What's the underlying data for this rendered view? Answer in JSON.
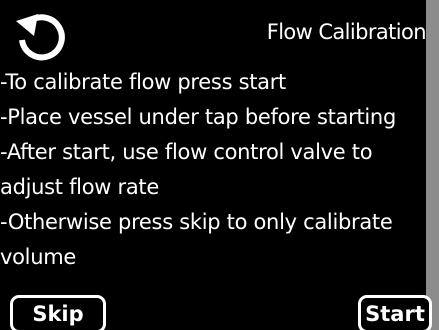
{
  "header": {
    "back_icon": "refresh-back-icon",
    "title": "Flow Calibration"
  },
  "instructions": {
    "lines": [
      "-To calibrate flow press start",
      "-Place vessel under tap before starting",
      "-After start, use flow control valve to",
      " adjust flow rate",
      "-Otherwise press skip to only calibrate",
      " volume"
    ]
  },
  "buttons": {
    "skip_label": "Skip",
    "start_label": "Start"
  },
  "colors": {
    "background": "#000000",
    "text": "#ffffff",
    "frame": "#8c8c8c"
  }
}
